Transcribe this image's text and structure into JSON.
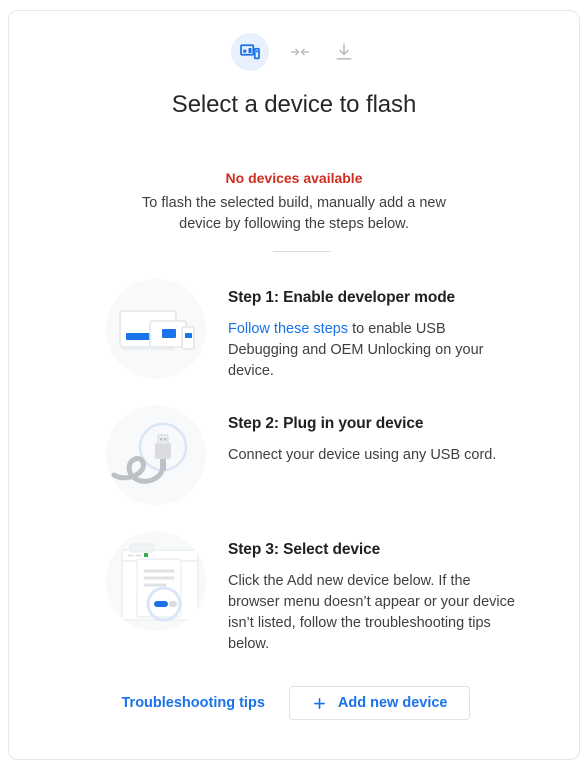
{
  "header": {
    "icons": [
      {
        "name": "devices-icon",
        "active": true
      },
      {
        "name": "merge-arrows-icon",
        "active": false
      },
      {
        "name": "download-icon",
        "active": false
      }
    ]
  },
  "title": "Select a device to flash",
  "status": {
    "error": "No devices available",
    "description": "To flash the selected build, manually add a new device by following the steps below."
  },
  "steps": [
    {
      "title": "Step 1: Enable developer mode",
      "art": "devices-illustration",
      "text_link": "Follow these steps",
      "text_rest": " to enable USB Debugging and OEM Unlocking on your device."
    },
    {
      "title": "Step 2: Plug in your device",
      "art": "usb-cable-illustration",
      "text": "Connect your device using any USB cord."
    },
    {
      "title": "Step 3: Select device",
      "art": "browser-dialog-illustration",
      "text": "Click the Add new device below. If the browser menu doesn’t appear or your device isn’t listed, follow the troubleshooting tips below."
    }
  ],
  "actions": {
    "troubleshooting_label": "Troubleshooting tips",
    "add_device_label": "Add new device",
    "add_device_icon": "plus-icon"
  },
  "colors": {
    "accent_blue": "#1a73e8",
    "error_red": "#d12b20",
    "icon_badge_bg": "#e8f0fe",
    "art_bg": "#f7f9fa",
    "text_primary": "#202124",
    "text_secondary": "#3c4043",
    "border": "#e4e6e8"
  }
}
